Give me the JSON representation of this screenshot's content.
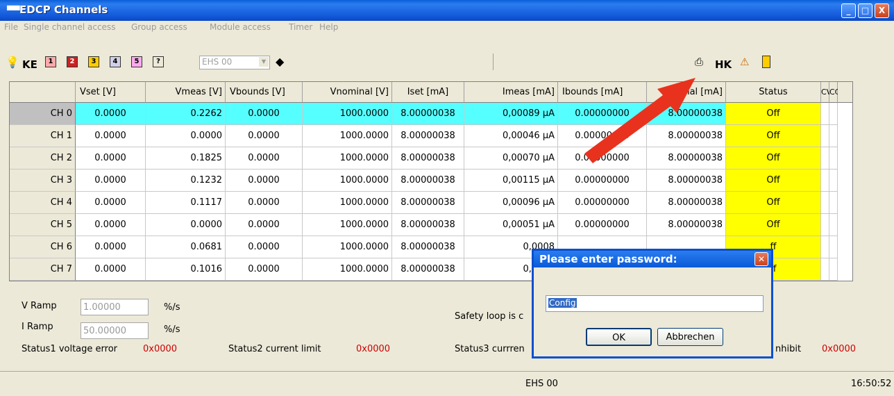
{
  "window": {
    "title": "EDCP Channels",
    "app_icon": "device-icon",
    "controls": [
      "_",
      "□",
      "X"
    ]
  },
  "menu": [
    "File",
    "Single channel access",
    "Group access",
    "Module access",
    "Timer",
    "Help"
  ],
  "toolbar": {
    "left_icons": [
      "lightbulb-icon",
      "KE",
      "1",
      "2",
      "3",
      "4",
      "5",
      "?"
    ],
    "key_labels": {
      "ke": "KE",
      "b1": "1",
      "b2": "2",
      "b3": "3",
      "b4": "4",
      "b5": "5",
      "q": "?"
    },
    "module_select": "EHS 00",
    "right": {
      "hk": "HK"
    }
  },
  "table": {
    "headers": [
      "",
      "Vset [V]",
      "Vmeas [V]",
      "Vbounds [V]",
      "Vnominal [V]",
      "Iset [mA]",
      "Imeas [mA]",
      "Ibounds [mA]",
      "nal [mA]",
      "Status",
      "CV",
      "CC"
    ],
    "rows": [
      {
        "ch": "CH 0",
        "vset": "0.0000",
        "vmeas": "0.2262",
        "vbounds": "0.0000",
        "vnominal": "1000.0000",
        "iset": "8.00000038",
        "imeas": "0,00089 µA",
        "ibounds": "0.00000000",
        "inominal": "8.00000038",
        "status": "Off"
      },
      {
        "ch": "CH 1",
        "vset": "0.0000",
        "vmeas": "0.0000",
        "vbounds": "0.0000",
        "vnominal": "1000.0000",
        "iset": "8.00000038",
        "imeas": "0,00046 µA",
        "ibounds": "0.00000000",
        "inominal": "8.00000038",
        "status": "Off"
      },
      {
        "ch": "CH 2",
        "vset": "0.0000",
        "vmeas": "0.1825",
        "vbounds": "0.0000",
        "vnominal": "1000.0000",
        "iset": "8.00000038",
        "imeas": "0,00070 µA",
        "ibounds": "0.00000000",
        "inominal": "8.00000038",
        "status": "Off"
      },
      {
        "ch": "CH 3",
        "vset": "0.0000",
        "vmeas": "0.1232",
        "vbounds": "0.0000",
        "vnominal": "1000.0000",
        "iset": "8.00000038",
        "imeas": "0,00115 µA",
        "ibounds": "0.00000000",
        "inominal": "8.00000038",
        "status": "Off"
      },
      {
        "ch": "CH 4",
        "vset": "0.0000",
        "vmeas": "0.1117",
        "vbounds": "0.0000",
        "vnominal": "1000.0000",
        "iset": "8.00000038",
        "imeas": "0,00096 µA",
        "ibounds": "0.00000000",
        "inominal": "8.00000038",
        "status": "Off"
      },
      {
        "ch": "CH 5",
        "vset": "0.0000",
        "vmeas": "0.0000",
        "vbounds": "0.0000",
        "vnominal": "1000.0000",
        "iset": "8.00000038",
        "imeas": "0,00051 µA",
        "ibounds": "0.00000000",
        "inominal": "8.00000038",
        "status": "Off"
      },
      {
        "ch": "CH 6",
        "vset": "0.0000",
        "vmeas": "0.0681",
        "vbounds": "0.0000",
        "vnominal": "1000.0000",
        "iset": "8.00000038",
        "imeas": "0,0008",
        "ibounds": "",
        "inominal": "",
        "status": "ff"
      },
      {
        "ch": "CH 7",
        "vset": "0.0000",
        "vmeas": "0.1016",
        "vbounds": "0.0000",
        "vnominal": "1000.0000",
        "iset": "8.00000038",
        "imeas": "0,0005",
        "ibounds": "",
        "inominal": "",
        "status": "ff"
      }
    ]
  },
  "bottom": {
    "v_ramp_label": "V Ramp",
    "v_ramp_value": "1.00000",
    "v_ramp_unit": "%/s",
    "i_ramp_label": "I Ramp",
    "i_ramp_value": "50.00000",
    "i_ramp_unit": "%/s",
    "safety_loop": "Safety loop is c",
    "status1_label": "Status1 voltage error",
    "status1_value": "0x0000",
    "status2_label": "Status2 current limit",
    "status2_value": "0x0000",
    "status3_label": "Status3 currren",
    "inhibit_label": "nhibit",
    "inhibit_value": "0x0000"
  },
  "statusbar": {
    "module": "EHS 00",
    "time": "16:50:52"
  },
  "dialog": {
    "title": "Please enter password:",
    "input_value": "Config",
    "ok_label": "OK",
    "cancel_label": "Abbrechen"
  },
  "colors": {
    "selected_row": "#55ffff",
    "status_off": "#ffff00",
    "arrow": "#e8321e"
  }
}
